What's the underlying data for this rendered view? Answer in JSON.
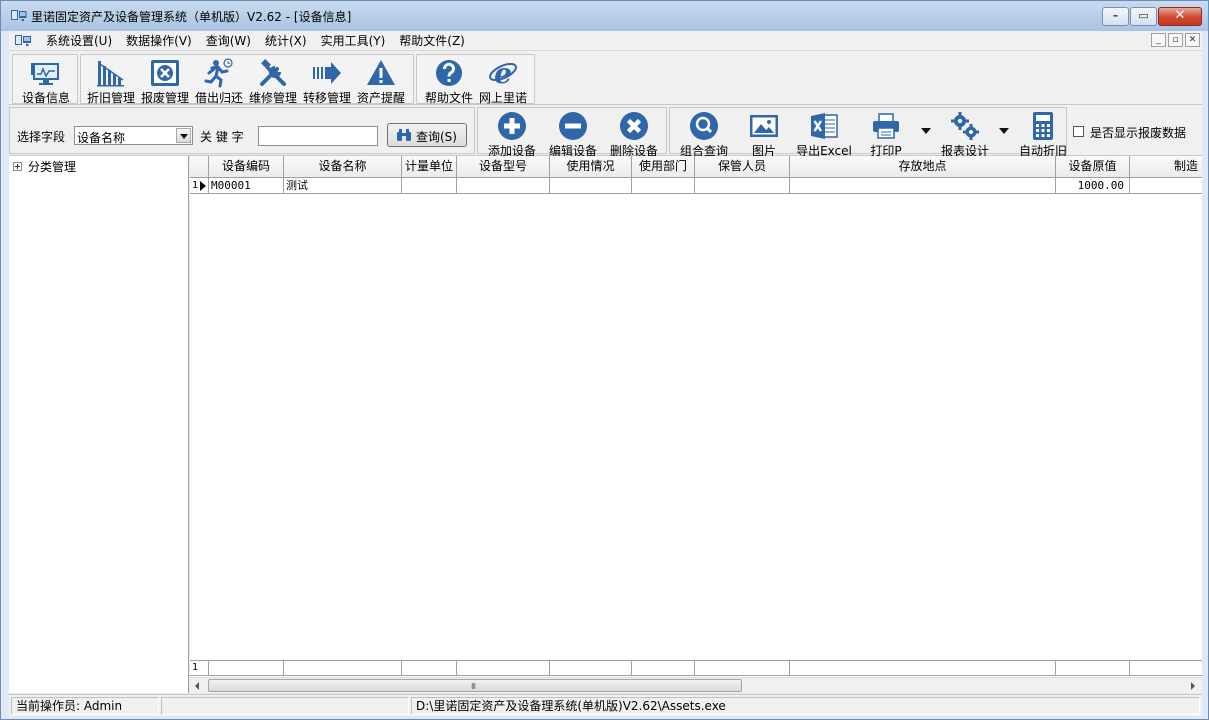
{
  "window": {
    "title": "里诺固定资产及设备管理系统（单机版）V2.62 - [设备信息]"
  },
  "menu": [
    "系统设置(U)",
    "数据操作(V)",
    "查询(W)",
    "统计(X)",
    "实用工具(Y)",
    "帮助文件(Z)"
  ],
  "toolbar1": [
    {
      "label": "设备信息",
      "icon": "monitor-icon"
    },
    {
      "label": "折旧管理",
      "icon": "bar-chart-icon"
    },
    {
      "label": "报废管理",
      "icon": "scrap-box-icon"
    },
    {
      "label": "借出归还",
      "icon": "running-person-icon"
    },
    {
      "label": "维修管理",
      "icon": "tools-icon"
    },
    {
      "label": "转移管理",
      "icon": "arrow-right-icon"
    },
    {
      "label": "资产提醒",
      "icon": "warning-icon"
    },
    {
      "label": "帮助文件",
      "icon": "help-icon"
    },
    {
      "label": "网上里诺",
      "icon": "internet-explorer-icon"
    }
  ],
  "search": {
    "field_label": "选择字段",
    "field_value": "设备名称",
    "keyword_label": "关 键 字",
    "keyword_value": "",
    "query_label": "查询(S)"
  },
  "toolbar2": [
    {
      "label": "添加设备",
      "icon": "add-circle-icon"
    },
    {
      "label": "编辑设备",
      "icon": "minus-circle-icon"
    },
    {
      "label": "删除设备",
      "icon": "delete-circle-icon"
    },
    {
      "label": "组合查询",
      "icon": "magnifier-icon"
    },
    {
      "label": "图片",
      "icon": "picture-icon"
    },
    {
      "label": "导出Excel",
      "icon": "excel-icon"
    },
    {
      "label": "打印P",
      "icon": "printer-icon"
    },
    {
      "label": "报表设计",
      "icon": "gears-icon"
    },
    {
      "label": "自动折旧",
      "icon": "calculator-icon"
    }
  ],
  "show_scrapped_label": "是否显示报废数据",
  "tree": {
    "root_label": "分类管理"
  },
  "grid": {
    "columns": [
      "设备编码",
      "设备名称",
      "计量单位",
      "设备型号",
      "使用情况",
      "使用部门",
      "保管人员",
      "存放地点",
      "设备原值",
      "制造"
    ],
    "rows": [
      {
        "index": "1",
        "code": "M00001",
        "name": "测试",
        "unit": "",
        "model": "",
        "usage": "",
        "dept": "",
        "keeper": "",
        "location": "",
        "value": "1000.00",
        "maker": ""
      }
    ],
    "footer_index": "1",
    "scroll_grip": "III"
  },
  "status": {
    "operator": "当前操作员: Admin",
    "middle": "",
    "path": "D:\\里诺固定资产及设备理系统(单机版)V2.62\\Assets.exe"
  },
  "colors": {
    "icon_blue": "#2f67a8",
    "title_blue": "#b7cde8"
  }
}
